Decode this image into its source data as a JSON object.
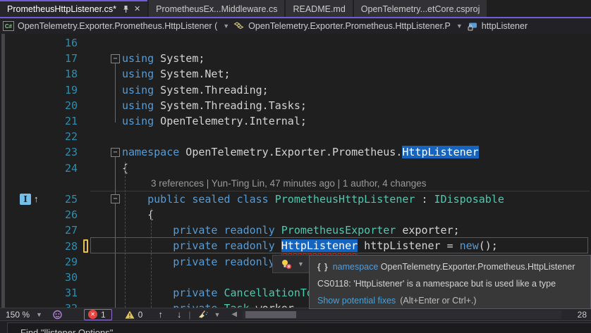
{
  "tabs": {
    "items": [
      {
        "label": "PrometheusHttpListener.cs*",
        "active": true,
        "pinned": true
      },
      {
        "label": "PrometheusEx...Middleware.cs",
        "active": false
      },
      {
        "label": "README.md",
        "active": false
      },
      {
        "label": "OpenTelemetry...etCore.csproj",
        "active": false
      }
    ]
  },
  "breadcrumb": {
    "project_label": "OpenTelemetry.Exporter.Prometheus.HttpListener (",
    "type_label": "OpenTelemetry.Exporter.Prometheus.HttpListener.P",
    "member_label": "httpListener"
  },
  "editor": {
    "codelens": "3 references | Yun-Ting Lin, 47 minutes ago | 1 author, 4 changes",
    "lines": [
      {
        "num": "16",
        "tokens": []
      },
      {
        "num": "17",
        "fold": true,
        "tokens": [
          [
            "kw",
            "using"
          ],
          [
            "pl",
            " System;"
          ]
        ]
      },
      {
        "num": "18",
        "tokens": [
          [
            "kw",
            "using"
          ],
          [
            "pl",
            " System.Net;"
          ]
        ]
      },
      {
        "num": "19",
        "tokens": [
          [
            "kw",
            "using"
          ],
          [
            "pl",
            " System.Threading;"
          ]
        ]
      },
      {
        "num": "20",
        "tokens": [
          [
            "kw",
            "using"
          ],
          [
            "pl",
            " System.Threading.Tasks;"
          ]
        ]
      },
      {
        "num": "21",
        "tokens": [
          [
            "kw",
            "using"
          ],
          [
            "pl",
            " OpenTelemetry.Internal;"
          ]
        ]
      },
      {
        "num": "22",
        "tokens": []
      },
      {
        "num": "23",
        "fold": true,
        "tokens": [
          [
            "kw",
            "namespace"
          ],
          [
            "pl",
            " OpenTelemetry.Exporter.Prometheus."
          ],
          [
            "hl",
            "HttpListener"
          ]
        ]
      },
      {
        "num": "24",
        "tokens": [
          [
            "pl",
            "{"
          ]
        ]
      },
      {
        "num": "",
        "codelens": true
      },
      {
        "num": "25",
        "fold": true,
        "badge": true,
        "tokens": [
          [
            "pl",
            "    "
          ],
          [
            "kw",
            "public"
          ],
          [
            "pl",
            " "
          ],
          [
            "kw",
            "sealed"
          ],
          [
            "pl",
            " "
          ],
          [
            "kw",
            "class"
          ],
          [
            "ty",
            " PrometheusHttpListener"
          ],
          [
            "pl",
            " : "
          ],
          [
            "ty",
            "IDisposable"
          ]
        ]
      },
      {
        "num": "26",
        "tokens": [
          [
            "pl",
            "    {"
          ]
        ]
      },
      {
        "num": "27",
        "tokens": [
          [
            "pl",
            "        "
          ],
          [
            "kw",
            "private"
          ],
          [
            "pl",
            " "
          ],
          [
            "kw",
            "readonly"
          ],
          [
            "ty",
            " PrometheusExporter"
          ],
          [
            "pl",
            " exporter;"
          ]
        ]
      },
      {
        "num": "28",
        "current": true,
        "changed": true,
        "tokens": [
          [
            "pl",
            "        "
          ],
          [
            "kw",
            "private"
          ],
          [
            "pl",
            " "
          ],
          [
            "kw",
            "readonly"
          ],
          [
            "pl",
            " "
          ],
          [
            "sq",
            "HttpListener"
          ],
          [
            "pl",
            " httpListener = "
          ],
          [
            "kw",
            "new"
          ],
          [
            "pl",
            "();"
          ]
        ]
      },
      {
        "num": "29",
        "tokens": [
          [
            "pl",
            "        "
          ],
          [
            "kw",
            "private"
          ],
          [
            "pl",
            " "
          ],
          [
            "kw",
            "readonly"
          ],
          [
            "pl",
            " b"
          ]
        ]
      },
      {
        "num": "30",
        "tokens": []
      },
      {
        "num": "31",
        "tokens": [
          [
            "pl",
            "        "
          ],
          [
            "kw",
            "private"
          ],
          [
            "pl",
            " "
          ],
          [
            "ty",
            "CancellationTokenSource"
          ]
        ]
      },
      {
        "num": "32",
        "tokens": [
          [
            "pl",
            "        "
          ],
          [
            "kw",
            "private"
          ],
          [
            "pl",
            " "
          ],
          [
            "ty",
            "Task"
          ],
          [
            "pl",
            " worker"
          ]
        ]
      }
    ]
  },
  "tooltip": {
    "braces": "{ }",
    "keyword": "namespace",
    "name": "OpenTelemetry.Exporter.Prometheus.HttpListener",
    "error": "CS0118: 'HttpListener' is a namespace but is used like a type",
    "link": "Show potential fixes",
    "shortcut": "(Alt+Enter or Ctrl+.)"
  },
  "bottom_bar": {
    "zoom_level": "150 %",
    "error_count": "1",
    "warning_count": "0",
    "scroll_indicator": "28"
  },
  "status_bar": {
    "text": "Find \"llistener Options\""
  },
  "colors": {
    "accent": "#6E5FD8",
    "selection_highlight": "#1565C0",
    "error": "#E8443E",
    "warning": "#E2C35C",
    "changed_line": "#E8C14C",
    "keyword": "#569CD6",
    "type": "#4EC9B0",
    "line_number": "#2F8EB0"
  }
}
